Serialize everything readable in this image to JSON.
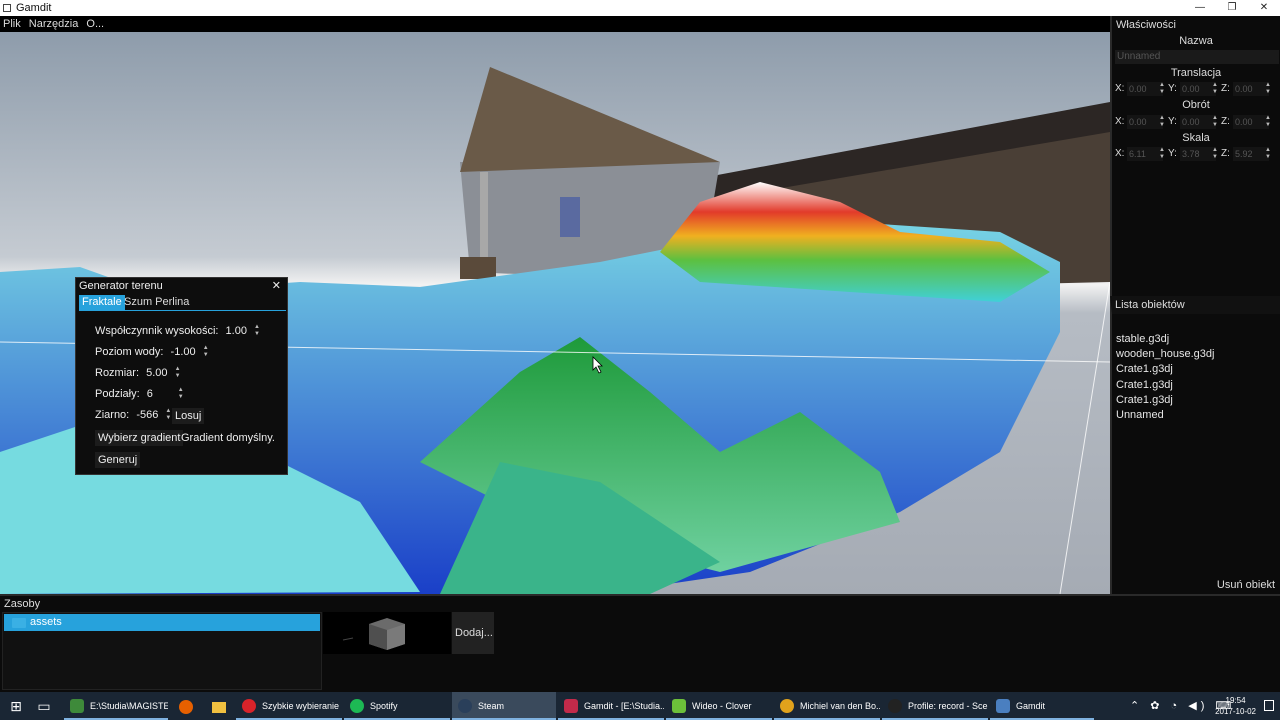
{
  "window": {
    "title": "Gamdit",
    "controls": [
      "—",
      "❐",
      "✕"
    ]
  },
  "menu": [
    "Plik",
    "Narzędzia",
    "O..."
  ],
  "properties": {
    "header": "Właściwości",
    "name_label": "Nazwa",
    "name_value": "Unnamed",
    "translation": {
      "label": "Translacja",
      "x": "0.00",
      "y": "0.00",
      "z": "0.00"
    },
    "rotation": {
      "label": "Obrót",
      "x": "0.00",
      "y": "0.00",
      "z": "0.00"
    },
    "scale": {
      "label": "Skala",
      "x": "6.11",
      "y": "3.78",
      "z": "5.92"
    },
    "axis": {
      "x": "X:",
      "y": "Y:",
      "z": "Z:"
    }
  },
  "objects": {
    "header": "Lista obiektów",
    "items": [
      "stable.g3dj",
      "wooden_house.g3dj",
      "Crate1.g3dj",
      "Crate1.g3dj",
      "Crate1.g3dj",
      "Unnamed"
    ],
    "delete_label": "Usuń obiekt"
  },
  "terrain": {
    "title": "Generator terenu",
    "close": "✕",
    "tabs": [
      "Fraktale",
      "Szum Perlina"
    ],
    "height_label": "Współczynnik wysokości:",
    "height_value": "1.00",
    "water_label": "Poziom wody:",
    "water_value": "-1.00",
    "size_label": "Rozmiar:",
    "size_value": "5.00",
    "div_label": "Podziały:",
    "div_value": "6",
    "seed_label": "Ziarno:",
    "seed_value": "-566",
    "random_label": "Losuj",
    "gradient_btn": "Wybierz gradient",
    "gradient_value": "Gradient domyślny.",
    "generate_label": "Generuj"
  },
  "assets": {
    "header": "Zasoby",
    "folder": "assets",
    "add_label": "Dodaj..."
  },
  "taskbar": {
    "tasks": [
      {
        "label": "E:\\Studia\\MAGISTE...",
        "color": "#3e8a3a"
      },
      {
        "label": "Szybkie wybieranie ...",
        "color": "#d8232a"
      },
      {
        "label": "Spotify",
        "color": "#1db954"
      },
      {
        "label": "Steam",
        "color": "#2a3f5a"
      },
      {
        "label": "Gamdit - [E:\\Studia...",
        "color": "#c22a4a"
      },
      {
        "label": "Wideo - Clover",
        "color": "#6cbf3a"
      },
      {
        "label": "Michiel van den Bo...",
        "color": "#e0a21c"
      },
      {
        "label": "Profile: record - Sce...",
        "color": "#222222"
      },
      {
        "label": "Gamdit",
        "color": "#4a7fc0"
      }
    ],
    "time": "19:54",
    "date": "2017-10-02"
  }
}
